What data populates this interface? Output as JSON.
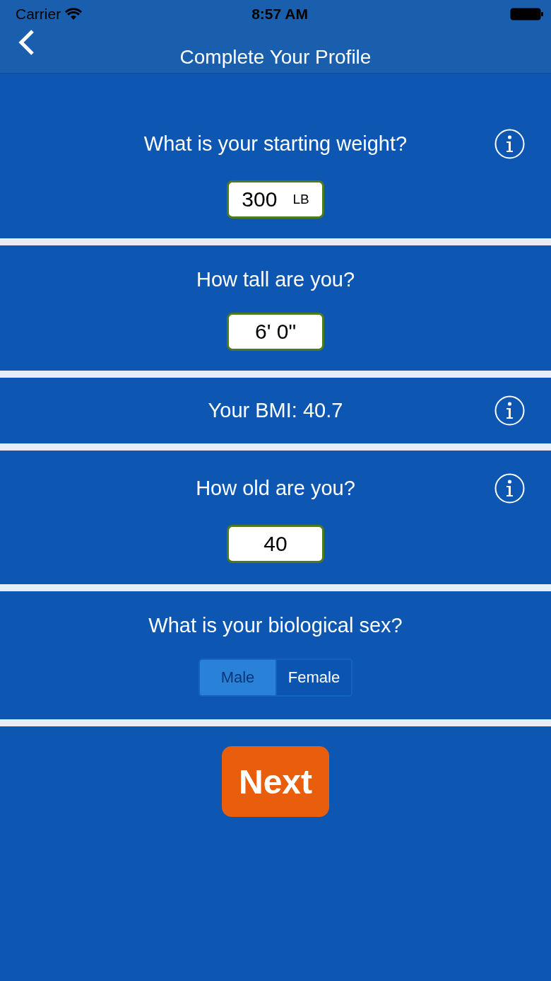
{
  "status_bar": {
    "carrier": "Carrier",
    "time": "8:57 AM"
  },
  "nav": {
    "title": "Complete Your Profile"
  },
  "sections": [
    {
      "kind": "input",
      "question": "What is your starting weight?",
      "info": true,
      "value": "300",
      "unit": "LB"
    },
    {
      "kind": "input",
      "question": "How tall are you?",
      "info": false,
      "value": "6' 0\""
    },
    {
      "kind": "readout",
      "question": "Your BMI: 40.7",
      "info": true
    },
    {
      "kind": "input",
      "question": "How old are you?",
      "info": true,
      "value": "40"
    },
    {
      "kind": "segmented",
      "question": "What is your biological sex?",
      "info": false,
      "options": [
        {
          "label": "Male",
          "selected": true
        },
        {
          "label": "Female",
          "selected": false
        }
      ]
    }
  ],
  "next_button": "Next"
}
